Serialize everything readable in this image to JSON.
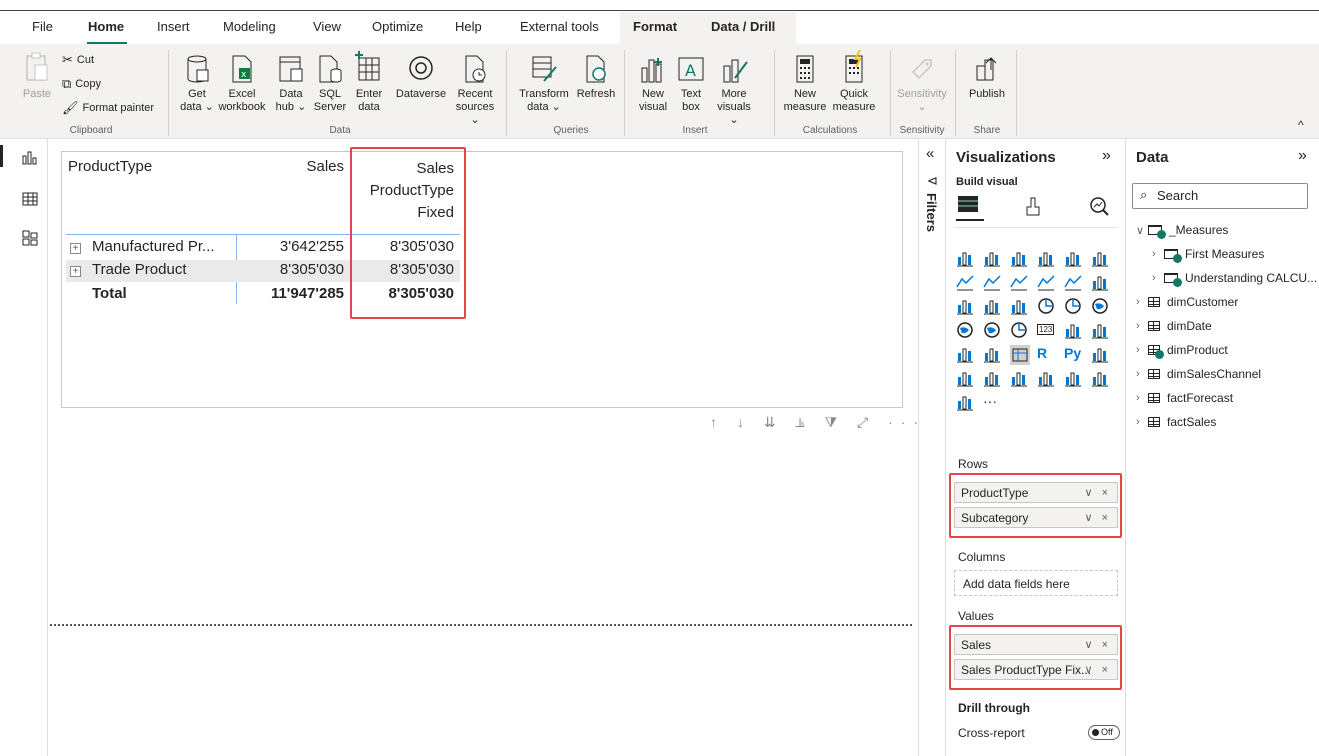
{
  "menu": {
    "tabs": [
      "File",
      "Home",
      "Insert",
      "Modeling",
      "View",
      "Optimize",
      "Help",
      "External tools",
      "Format",
      "Data / Drill"
    ],
    "active": "Home"
  },
  "ribbon": {
    "clipboard": {
      "paste": "Paste",
      "cut": "Cut",
      "copy": "Copy",
      "format_painter": "Format painter",
      "label": "Clipboard"
    },
    "data": {
      "get_data": [
        "Get",
        "data ⌄"
      ],
      "excel": [
        "Excel",
        "workbook"
      ],
      "data_hub": [
        "Data",
        "hub ⌄"
      ],
      "sql": [
        "SQL",
        "Server"
      ],
      "enter_data": [
        "Enter",
        "data"
      ],
      "dataverse": [
        "Dataverse",
        ""
      ],
      "recent": [
        "Recent",
        "sources ⌄"
      ],
      "label": "Data"
    },
    "queries": {
      "transform": [
        "Transform",
        "data ⌄"
      ],
      "refresh": [
        "Refresh",
        ""
      ],
      "label": "Queries"
    },
    "insert": {
      "new_visual": [
        "New",
        "visual"
      ],
      "text_box": [
        "Text",
        "box"
      ],
      "more_visuals": [
        "More",
        "visuals ⌄"
      ],
      "label": "Insert"
    },
    "calculations": {
      "new_measure": [
        "New",
        "measure"
      ],
      "quick_measure": [
        "Quick",
        "measure"
      ],
      "label": "Calculations"
    },
    "sensitivity": {
      "btn": [
        "Sensitivity",
        "⌄"
      ],
      "label": "Sensitivity"
    },
    "share": {
      "publish": [
        "Publish",
        ""
      ],
      "label": "Share"
    },
    "collapse": "^"
  },
  "table": {
    "headers": {
      "col1": "ProductType",
      "col2": "Sales",
      "col3": [
        "Sales",
        "ProductType",
        "Fixed"
      ]
    },
    "rows": [
      {
        "label": "Manufactured Pr...",
        "sales": "3'642'255",
        "fixed": "8'305'030",
        "expand": "+"
      },
      {
        "label": "Trade Product",
        "sales": "8'305'030",
        "fixed": "8'305'030",
        "expand": "+"
      }
    ],
    "total": {
      "label": "Total",
      "sales": "11'947'285",
      "fixed": "8'305'030"
    }
  },
  "visual_toolbar": {
    "icons": [
      "↑",
      "↓",
      "⇊",
      "⫡",
      "⧩",
      "⤢",
      "···"
    ]
  },
  "filters": {
    "label": "Filters",
    "collapse": "«",
    "toggle": "⊲"
  },
  "viz": {
    "title": "Visualizations",
    "expand": "»",
    "build_visual": "Build visual",
    "rows_label": "Rows",
    "rows": [
      "ProductType",
      "Subcategory"
    ],
    "columns_label": "Columns",
    "columns_placeholder": "Add data fields here",
    "values_label": "Values",
    "values": [
      "Sales",
      "Sales ProductType Fix..."
    ],
    "drill_through": "Drill through",
    "cross_report": "Cross-report",
    "toggle_off": "Off",
    "pill_controls": "∨ ×",
    "more": "···",
    "r_label": "R",
    "py_label": "Py",
    "num_label": "123"
  },
  "data_pane": {
    "title": "Data",
    "expand": "»",
    "search_placeholder": "Search",
    "items": [
      {
        "label": "_Measures",
        "kind": "measures",
        "expanded": true,
        "indent": 0
      },
      {
        "label": "First Measures",
        "kind": "folder",
        "expanded": false,
        "indent": 1
      },
      {
        "label": "Understanding CALCU...",
        "kind": "folder",
        "expanded": false,
        "indent": 1
      },
      {
        "label": "dimCustomer",
        "kind": "table",
        "expanded": false,
        "indent": 0
      },
      {
        "label": "dimDate",
        "kind": "table",
        "expanded": false,
        "indent": 0
      },
      {
        "label": "dimProduct",
        "kind": "table-check",
        "expanded": false,
        "indent": 0
      },
      {
        "label": "dimSalesChannel",
        "kind": "table",
        "expanded": false,
        "indent": 0
      },
      {
        "label": "factForecast",
        "kind": "table",
        "expanded": false,
        "indent": 0
      },
      {
        "label": "factSales",
        "kind": "table",
        "expanded": false,
        "indent": 0
      }
    ]
  },
  "colors": {
    "accent": "#117865",
    "highlight": "#e3464a",
    "ribbon_bg": "#f3f2f1"
  }
}
